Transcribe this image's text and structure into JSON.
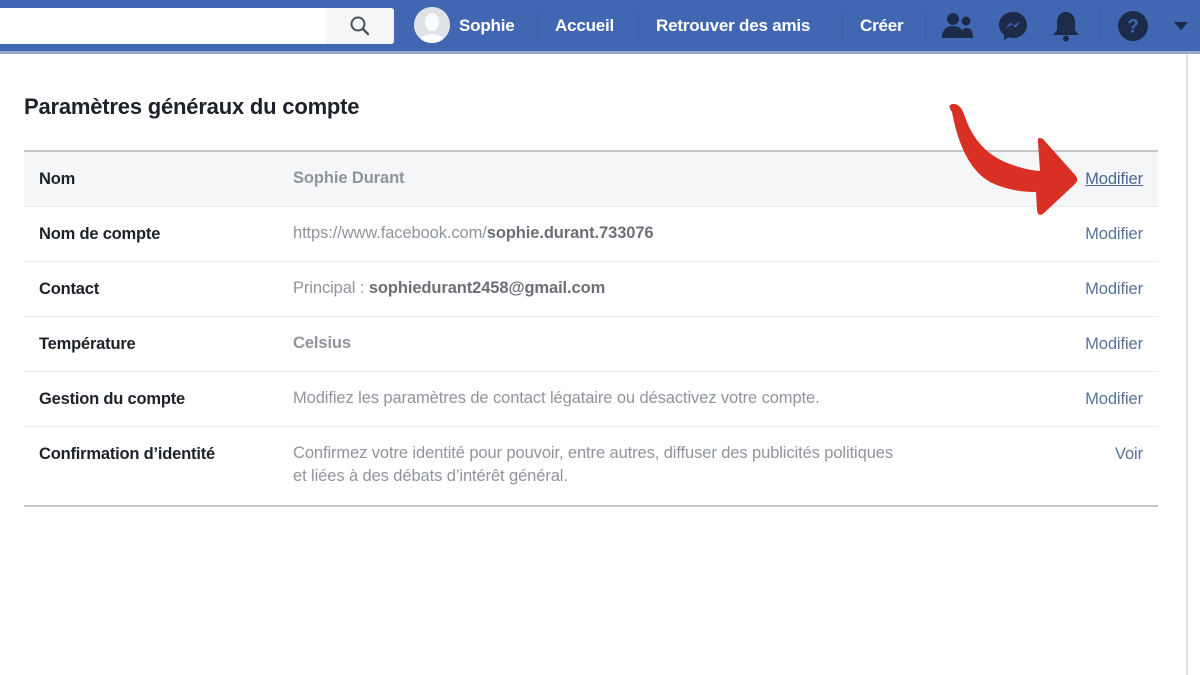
{
  "topbar": {
    "search": {
      "placeholder": "",
      "value": ""
    },
    "search_icon": "search-icon",
    "user_name": "Sophie",
    "links": [
      "Accueil",
      "Retrouver des amis",
      "Créer"
    ],
    "icons": [
      "friends-icon",
      "messenger-icon",
      "notifications-bell-icon",
      "help-icon",
      "dropdown-caret-icon"
    ]
  },
  "page": {
    "title": "Paramètres généraux du compte"
  },
  "settings": [
    {
      "label": "Nom",
      "value": "Sophie Durant",
      "action": "Modifier",
      "highlighted": true
    },
    {
      "label": "Nom de compte",
      "value_prefix": "https://www.facebook.com/",
      "value_bold": "sophie.durant.733076",
      "action": "Modifier"
    },
    {
      "label": "Contact",
      "value_prefix": "Principal : ",
      "value_bold": "sophiedurant2458@gmail.com",
      "action": "Modifier"
    },
    {
      "label": "Température",
      "value": "Celsius",
      "action": "Modifier"
    },
    {
      "label": "Gestion du compte",
      "value": "Modifiez les paramètres de contact légataire ou désactivez votre compte.",
      "action": "Modifier"
    },
    {
      "label": "Confirmation d’identité",
      "value_line1": "Confirmez votre identité pour pouvoir, entre autres, diffuser des publicités politiques",
      "value_line2": "et liées à des débats d’intérêt général.",
      "action": "Voir"
    }
  ],
  "annotation": {
    "type": "arrow",
    "color": "#d93025",
    "points_to": "Modifier"
  }
}
